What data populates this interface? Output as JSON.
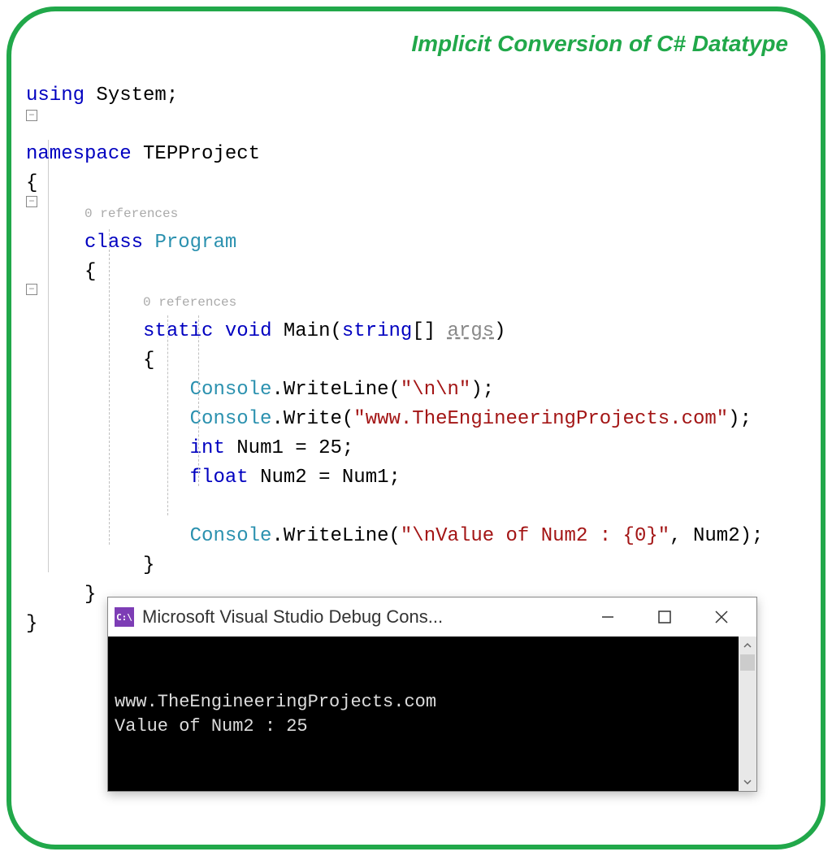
{
  "title": "Implicit Conversion of C# Datatype",
  "code": {
    "using_kw": "using",
    "using_ns": "System",
    "namespace_kw": "namespace",
    "namespace_name": "TEPProject",
    "refs0": "0 references",
    "class_kw": "class",
    "class_name": "Program",
    "refs1": "0 references",
    "static_kw": "static",
    "void_kw": "void",
    "main_name": "Main",
    "string_kw": "string",
    "args_name": "args",
    "console_type": "Console",
    "writeline": "WriteLine",
    "write": "Write",
    "str_nn": "\"\\n\\n\"",
    "str_site": "\"www.TheEngineeringProjects.com\"",
    "int_kw": "int",
    "num1_name": "Num1",
    "num1_val": "25",
    "float_kw": "float",
    "num2_name": "Num2",
    "str_out": "\"\\nValue of Num2 : {0}\"",
    "lbrace": "{",
    "rbrace": "}",
    "fold_minus": "−"
  },
  "console": {
    "icon_text": "C:\\",
    "title": "Microsoft Visual Studio Debug Cons...",
    "line1": "www.TheEngineeringProjects.com",
    "line2": "Value of Num2 : 25"
  }
}
